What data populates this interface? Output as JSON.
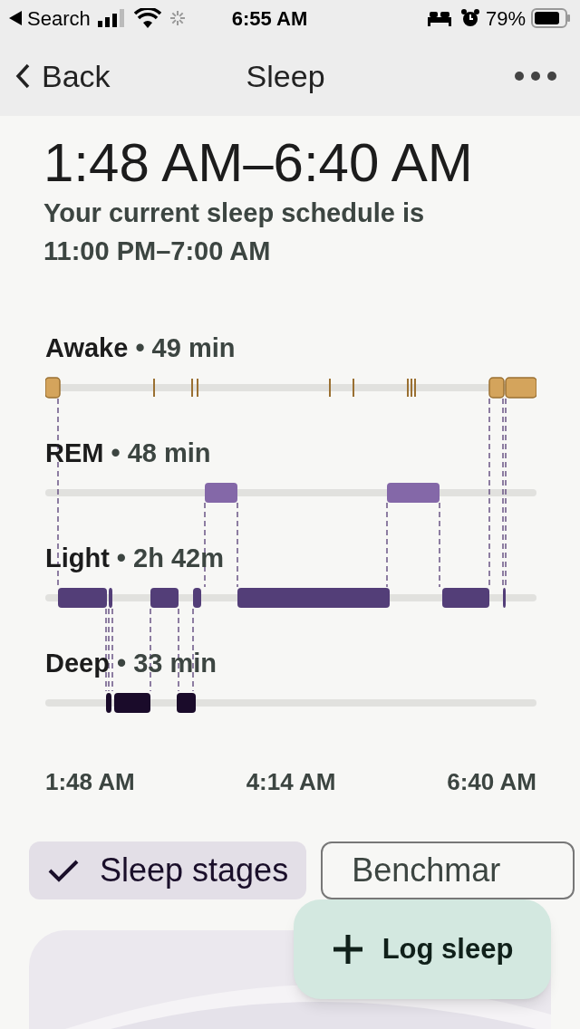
{
  "status_bar": {
    "back_app": "Search",
    "time": "6:55 AM",
    "battery": "79%"
  },
  "nav": {
    "back": "Back",
    "title": "Sleep"
  },
  "session": {
    "range": "1:48 AM–6:40 AM",
    "schedule": "Your current sleep schedule is 11:00 PM–7:00 AM"
  },
  "stages": [
    {
      "name": "Awake",
      "duration": "• 49 min",
      "color": "#d4a45c"
    },
    {
      "name": "REM",
      "duration": "• 48 min",
      "color": "#8468a8"
    },
    {
      "name": "Light",
      "duration": "• 2h 42m",
      "color": "#533e78"
    },
    {
      "name": "Deep",
      "duration": "• 33 min",
      "color": "#1a0b2a"
    }
  ],
  "time_axis": [
    "1:48 AM",
    "4:14 AM",
    "6:40 AM"
  ],
  "chips": [
    {
      "label": "Sleep stages",
      "selected": true
    },
    {
      "label": "Benchmar",
      "selected": false
    }
  ],
  "fab": {
    "label": "Log sleep"
  }
}
